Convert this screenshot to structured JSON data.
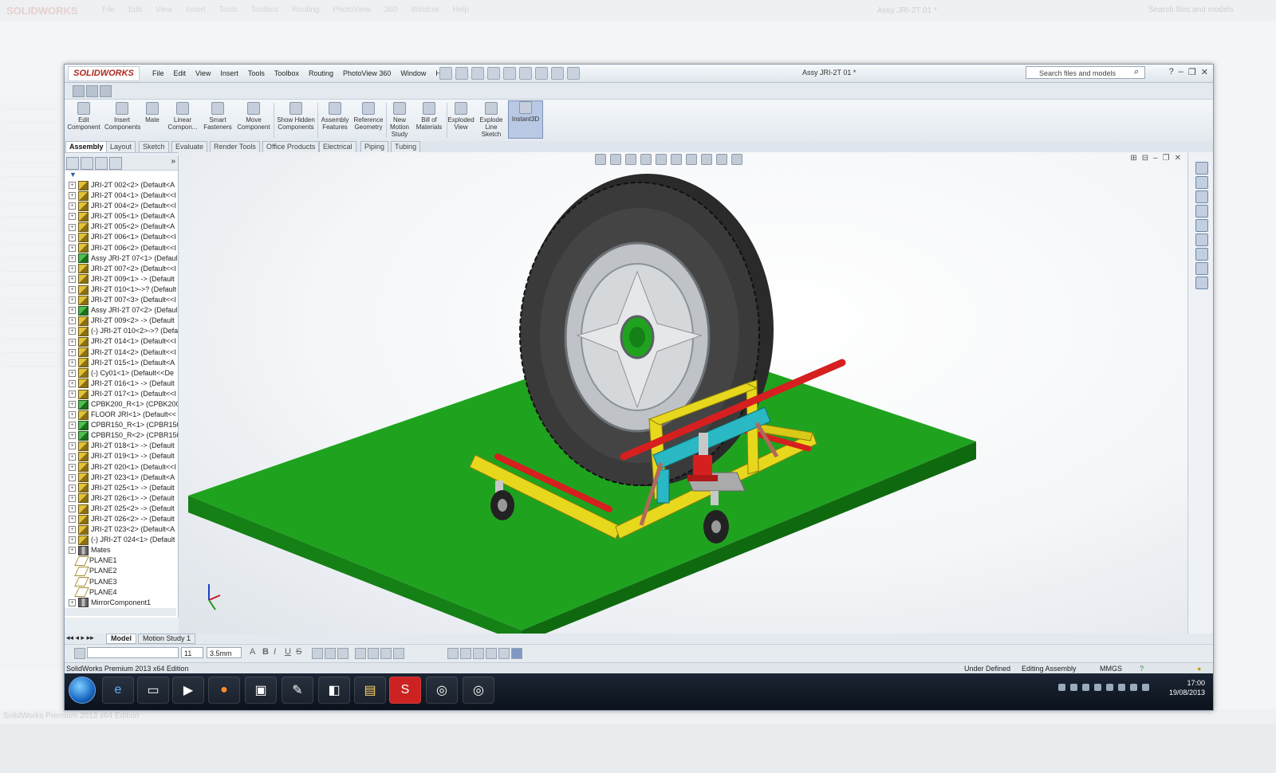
{
  "ghost": {
    "brand": "SOLIDWORKS",
    "menu": "File Edit View Insert Tools Toolbox Routing PhotoView 360 Window Help",
    "title": "Assy JRI-2T 01 *",
    "search": "Search files and models",
    "status": "SolidWorks Premium 2013 x64 Edition"
  },
  "window": {
    "brand": "SOLIDWORKS",
    "doc_title": "Assy JRI-2T 01 *",
    "search_placeholder": "Search files and models",
    "menu": [
      "File",
      "Edit",
      "View",
      "Insert",
      "Tools",
      "Toolbox",
      "Routing",
      "PhotoView 360",
      "Window",
      "Help"
    ]
  },
  "command_manager": [
    {
      "label": "Edit Component"
    },
    {
      "label": "Insert Components"
    },
    {
      "label": "Mate"
    },
    {
      "label": "Linear Compon..."
    },
    {
      "label": "Smart Fasteners"
    },
    {
      "label": "Move Component"
    },
    {
      "label": "Show Hidden Components"
    },
    {
      "label": "Assembly Features"
    },
    {
      "label": "Reference Geometry"
    },
    {
      "label": "New Motion Study"
    },
    {
      "label": "Bill of Materials"
    },
    {
      "label": "Exploded View"
    },
    {
      "label": "Explode Line Sketch"
    },
    {
      "label": "Instant3D"
    }
  ],
  "tabs": [
    "Assembly",
    "Layout",
    "Sketch",
    "Evaluate",
    "Render Tools",
    "Office Products",
    "Electrical",
    "Piping",
    "Tubing"
  ],
  "tree": [
    {
      "label": "JRI-2T 002<2> (Default<A",
      "icon": "part"
    },
    {
      "label": "JRI-2T 004<1> (Default<<I",
      "icon": "part"
    },
    {
      "label": "JRI-2T 004<2> (Default<<I",
      "icon": "part"
    },
    {
      "label": "JRI-2T 005<1> (Default<A",
      "icon": "part"
    },
    {
      "label": "JRI-2T 005<2> (Default<A",
      "icon": "part"
    },
    {
      "label": "JRI-2T 006<1> (Default<<I",
      "icon": "part"
    },
    {
      "label": "JRI-2T 006<2> (Default<<I",
      "icon": "part"
    },
    {
      "label": "Assy JRI-2T 07<1> (Defaul",
      "icon": "assy"
    },
    {
      "label": "JRI-2T 007<2> (Default<<I",
      "icon": "part"
    },
    {
      "label": "JRI-2T 009<1> -> (Default",
      "icon": "part"
    },
    {
      "label": "JRI-2T 010<1>->? (Default",
      "icon": "part"
    },
    {
      "label": "JRI-2T 007<3> (Default<<I",
      "icon": "part"
    },
    {
      "label": "Assy JRI-2T 07<2> (Defaul",
      "icon": "assy"
    },
    {
      "label": "JRI-2T 009<2> -> (Default",
      "icon": "part"
    },
    {
      "label": "(-) JRI-2T 010<2>->? (Defa",
      "icon": "part"
    },
    {
      "label": "JRI-2T 014<1> (Default<<I",
      "icon": "part"
    },
    {
      "label": "JRI-2T 014<2> (Default<<I",
      "icon": "part"
    },
    {
      "label": "JRI-2T 015<1> (Default<A",
      "icon": "part"
    },
    {
      "label": "(-) Cy01<1> (Default<<De",
      "icon": "part"
    },
    {
      "label": "JRI-2T 016<1> -> (Default",
      "icon": "part"
    },
    {
      "label": "JRI-2T 017<1> (Default<<I",
      "icon": "part"
    },
    {
      "label": "CPBK200_R<1> (CPBK200-",
      "icon": "assy"
    },
    {
      "label": "FLOOR JRI<1> (Default<<",
      "icon": "part"
    },
    {
      "label": "CPBR150_R<1> (CPBR150-",
      "icon": "assy"
    },
    {
      "label": "CPBR150_R<2> (CPBR150-",
      "icon": "assy"
    },
    {
      "label": "JRI-2T 018<1> -> (Default",
      "icon": "part"
    },
    {
      "label": "JRI-2T 019<1> -> (Default",
      "icon": "part"
    },
    {
      "label": "JRI-2T 020<1> (Default<<I",
      "icon": "part"
    },
    {
      "label": "JRI-2T 023<1> (Default<A",
      "icon": "part"
    },
    {
      "label": "JRI-2T 025<1> -> (Default",
      "icon": "part"
    },
    {
      "label": "JRI-2T 026<1> -> (Default",
      "icon": "part"
    },
    {
      "label": "JRI-2T 025<2> -> (Default",
      "icon": "part"
    },
    {
      "label": "JRI-2T 026<2> -> (Default",
      "icon": "part"
    },
    {
      "label": "JRI-2T 023<2> (Default<A",
      "icon": "part"
    },
    {
      "label": "(-) JRI-2T 024<1> (Default",
      "icon": "part"
    },
    {
      "label": "Mates",
      "icon": "mates"
    },
    {
      "label": "PLANE1",
      "icon": "plane"
    },
    {
      "label": "PLANE2",
      "icon": "plane"
    },
    {
      "label": "PLANE3",
      "icon": "plane"
    },
    {
      "label": "PLANE4",
      "icon": "plane"
    },
    {
      "label": "MirrorComponent1",
      "icon": "mates"
    }
  ],
  "bottom_tabs": [
    "Model",
    "Motion Study 1"
  ],
  "format_bar": {
    "font_size": "11",
    "line_width": "3.5mm"
  },
  "status": {
    "edition": "SolidWorks Premium 2013 x64 Edition",
    "state": "Under Defined",
    "mode": "Editing Assembly",
    "units": "MMGS"
  },
  "clock": {
    "time": "17:00",
    "date": "19/08/2013"
  },
  "colors": {
    "floor": "#1fa31f",
    "frame": "#e8d81d",
    "rod": "#d61f1f",
    "bracket": "#29b8c4",
    "tyre": "#3a3a3a"
  },
  "taskbar_apps": [
    "ie-icon",
    "folder-icon",
    "media-player-icon",
    "firefox-icon",
    "monitor-icon",
    "paint-icon",
    "office-icon",
    "explorer-icon",
    "solidworks-icon",
    "edrawings-icon",
    "edrawings-icon"
  ]
}
